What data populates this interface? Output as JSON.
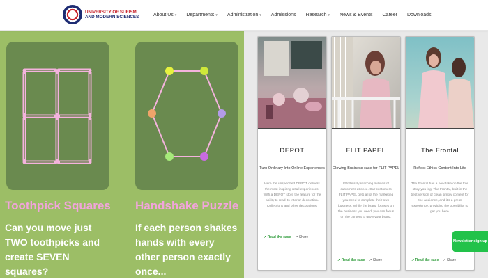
{
  "header": {
    "logo_line1": "UNIVERSITY OF SUFISM",
    "logo_line2": "AND MODERN SCIENCES",
    "nav": [
      {
        "label": "About Us",
        "dropdown": true
      },
      {
        "label": "Departments",
        "dropdown": true
      },
      {
        "label": "Administration",
        "dropdown": true
      },
      {
        "label": "Admissions",
        "dropdown": false
      },
      {
        "label": "Research",
        "dropdown": true
      },
      {
        "label": "News & Events",
        "dropdown": false
      },
      {
        "label": "Career",
        "dropdown": false
      },
      {
        "label": "Downloads",
        "dropdown": false
      }
    ]
  },
  "puzzles": [
    {
      "title": "Toothpick Squares",
      "description": "Can you move just TWO toothpicks and create SEVEN squares?"
    },
    {
      "title": "Handshake Puzzle",
      "description": "If each person shakes hands with every other person exactly once..."
    }
  ],
  "products": [
    {
      "name": "DEPOT",
      "subtitle": "Turn Ordinary Into Online Experiences",
      "body": "Here the unspecified DEPOT delivers the most inspiring retail experiences. With a DEPOT store the feature for the ability to read its Interior decoration. Collections and other decorations.",
      "read_more": "Read the case",
      "share": "Share"
    },
    {
      "name": "FLIT PAPEL",
      "subtitle": "Glowing Business case for FLIT PAPEL",
      "body": "Effortlessly reaching millions of customers at once. Our customers FLIT PAPEL gets all of the marketing you need to complete their own business. While the brand focuses on the business you need, you can focus on the content to grow your brand.",
      "read_more": "Read the case",
      "share": "Share"
    },
    {
      "name": "The Frontal",
      "subtitle": "Reflect Ethics Content Into Life",
      "body": "The Frontal has a new take on the true story you log. The Frontal, built in the best version of clean simply content for the audience, and it's a great experience, providing the possibility to get you here.",
      "read_more": "Read the case",
      "share": "Share"
    }
  ],
  "newsletter": {
    "label": "Newsletter sign up"
  },
  "colors": {
    "puzzle_bg": "#9cbe66",
    "card_bg": "#6a8a4f",
    "puzzle_title": "#f2a4dc",
    "accent_green": "#22c24a",
    "brand_red": "#c8232c",
    "brand_blue": "#1e2c73"
  }
}
